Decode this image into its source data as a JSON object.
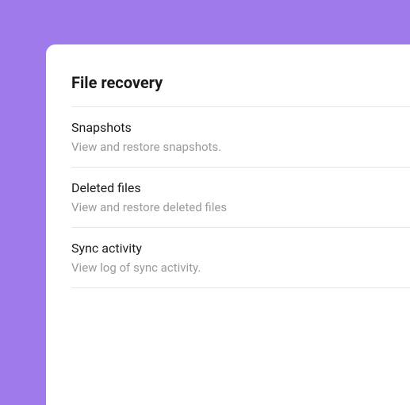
{
  "section": {
    "title": "File recovery"
  },
  "items": [
    {
      "title": "Snapshots",
      "description": "View and restore snapshots."
    },
    {
      "title": "Deleted files",
      "description": "View and restore deleted files"
    },
    {
      "title": "Sync activity",
      "description": "View log of sync activity."
    }
  ]
}
